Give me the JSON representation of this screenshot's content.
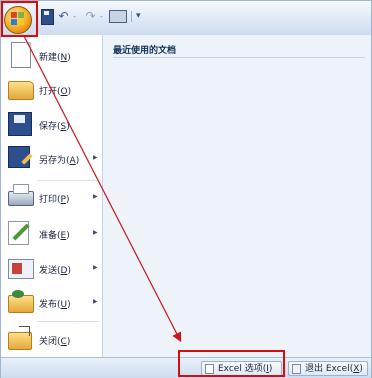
{
  "quick_access_toolbar": {
    "office_button_icon": "office-logo-icon",
    "save_icon": "save-icon",
    "undo_icon": "undo-icon",
    "redo_icon": "redo-icon",
    "camera_icon": "screenshot-icon",
    "customize_icon": "chevron-down-icon",
    "undo_glyph": "↶",
    "redo_glyph": "↷",
    "customize_glyph": "▾",
    "small_dash_1": "-",
    "small_dash_2": "-"
  },
  "office_menu": {
    "items": [
      {
        "label": "新建(",
        "key": "N",
        "suffix": ")",
        "icon": "new-document-icon",
        "has_submenu": false
      },
      {
        "label": "打开(",
        "key": "O",
        "suffix": ")",
        "icon": "open-folder-icon",
        "has_submenu": false
      },
      {
        "label": "保存(",
        "key": "S",
        "suffix": ")",
        "icon": "save-disk-icon",
        "has_submenu": false
      },
      {
        "label": "另存为(",
        "key": "A",
        "suffix": ")",
        "icon": "save-as-icon",
        "has_submenu": true
      },
      {
        "label": "打印(",
        "key": "P",
        "suffix": ")",
        "icon": "printer-icon",
        "has_submenu": true
      },
      {
        "label": "准备(",
        "key": "E",
        "suffix": ")",
        "icon": "prepare-icon",
        "has_submenu": true
      },
      {
        "label": "发送(",
        "key": "D",
        "suffix": ")",
        "icon": "send-icon",
        "has_submenu": true
      },
      {
        "label": "发布(",
        "key": "U",
        "suffix": ")",
        "icon": "publish-icon",
        "has_submenu": true
      },
      {
        "label": "关闭(",
        "key": "C",
        "suffix": ")",
        "icon": "close-folder-icon",
        "has_submenu": false
      }
    ],
    "submenu_arrow": "▶"
  },
  "recent_documents": {
    "title": "最近使用的文档"
  },
  "bottom_bar": {
    "options_button": {
      "label": "Excel 选项(",
      "key": "I",
      "suffix": ")"
    },
    "exit_button": {
      "label": "退出 Excel(",
      "key": "X",
      "suffix": ")"
    }
  },
  "annotation": {
    "highlight_color": "#d40e0e"
  }
}
